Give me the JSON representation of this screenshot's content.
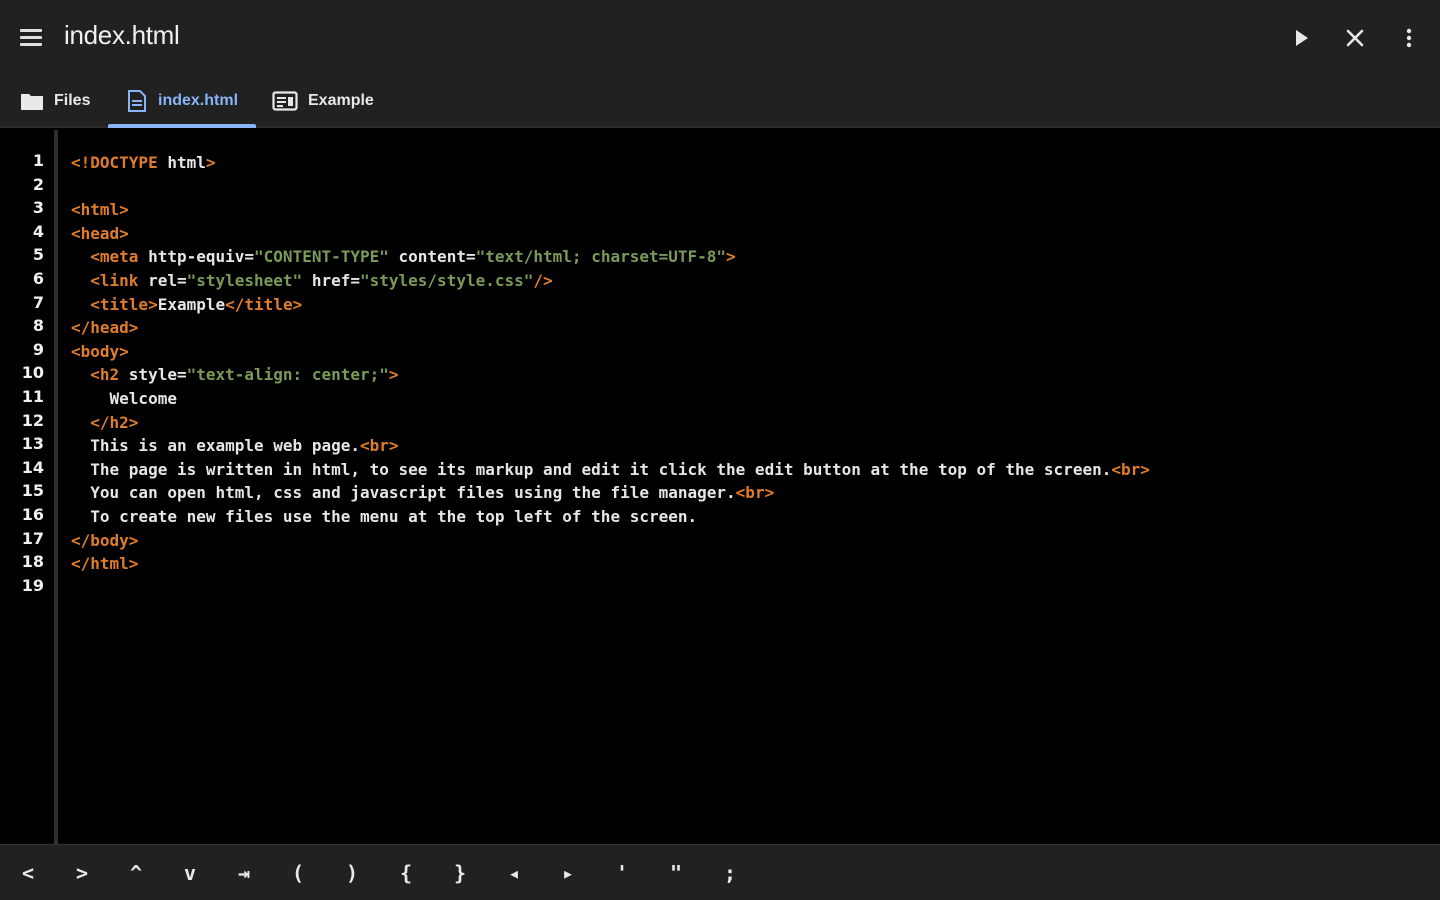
{
  "appbar": {
    "title": "index.html",
    "menu_icon": "hamburger-menu-icon",
    "actions": [
      {
        "name": "run-button",
        "icon": "play-icon"
      },
      {
        "name": "close-button",
        "icon": "close-icon"
      },
      {
        "name": "overflow-menu-button",
        "icon": "more-vert-icon"
      }
    ]
  },
  "tabs": [
    {
      "label": "Files",
      "icon": "folder-icon",
      "active": false
    },
    {
      "label": "index.html",
      "icon": "document-icon",
      "active": true
    },
    {
      "label": "Example",
      "icon": "web-preview-icon",
      "active": false
    }
  ],
  "editor": {
    "line_numbers": [
      "1",
      "2",
      "3",
      "4",
      "5",
      "6",
      "7",
      "8",
      "9",
      "10",
      "11",
      "12",
      "13",
      "14",
      "15",
      "16",
      "17",
      "18",
      "19"
    ],
    "lines": [
      [
        [
          "tag",
          "<!DOCTYPE "
        ],
        [
          "attr",
          "html"
        ],
        [
          "tag",
          ">"
        ]
      ],
      [],
      [
        [
          "tag",
          "<html>"
        ]
      ],
      [
        [
          "tag",
          "<head>"
        ]
      ],
      [
        [
          "text",
          "  "
        ],
        [
          "tag",
          "<meta "
        ],
        [
          "attr",
          "http-equiv="
        ],
        [
          "str",
          "\"CONTENT-TYPE\""
        ],
        [
          "attr",
          " content="
        ],
        [
          "str",
          "\"text/html; charset=UTF-8\""
        ],
        [
          "tag",
          ">"
        ]
      ],
      [
        [
          "text",
          "  "
        ],
        [
          "tag",
          "<link "
        ],
        [
          "attr",
          "rel="
        ],
        [
          "str",
          "\"stylesheet\""
        ],
        [
          "attr",
          " href="
        ],
        [
          "str",
          "\"styles/style.css\""
        ],
        [
          "tag",
          "/>"
        ]
      ],
      [
        [
          "text",
          "  "
        ],
        [
          "tag",
          "<title>"
        ],
        [
          "text",
          "Example"
        ],
        [
          "tag",
          "</title>"
        ]
      ],
      [
        [
          "tag",
          "</head>"
        ]
      ],
      [
        [
          "tag",
          "<body>"
        ]
      ],
      [
        [
          "text",
          "  "
        ],
        [
          "tag",
          "<h2 "
        ],
        [
          "attr",
          "style="
        ],
        [
          "str",
          "\"text-align: center;\""
        ],
        [
          "tag",
          ">"
        ]
      ],
      [
        [
          "text",
          "    Welcome"
        ]
      ],
      [
        [
          "text",
          "  "
        ],
        [
          "tag",
          "</h2>"
        ]
      ],
      [
        [
          "text",
          "  This is an example web page."
        ],
        [
          "tag",
          "<br>"
        ]
      ],
      [
        [
          "text",
          "  The page is written in html, to see its markup and edit it click the edit button at the top of the screen."
        ],
        [
          "tag",
          "<br>"
        ]
      ],
      [
        [
          "text",
          "  You can open html, css and javascript files using the file manager."
        ],
        [
          "tag",
          "<br>"
        ]
      ],
      [
        [
          "text",
          "  To create new files use the menu at the top left of the screen."
        ]
      ],
      [
        [
          "tag",
          "</body>"
        ]
      ],
      [
        [
          "tag",
          "</html>"
        ]
      ],
      []
    ]
  },
  "keybar": {
    "keys": [
      {
        "name": "cursor-left-key",
        "label": "<"
      },
      {
        "name": "cursor-right-key",
        "label": ">"
      },
      {
        "name": "cursor-up-key",
        "label": "^"
      },
      {
        "name": "cursor-down-key",
        "label": "v"
      },
      {
        "name": "tab-key",
        "label": "⇥"
      },
      {
        "name": "open-paren-key",
        "label": "("
      },
      {
        "name": "close-paren-key",
        "label": ")"
      },
      {
        "name": "open-brace-key",
        "label": "{"
      },
      {
        "name": "close-brace-key",
        "label": "}"
      },
      {
        "name": "less-than-key",
        "label": "◂"
      },
      {
        "name": "greater-than-key",
        "label": "▸"
      },
      {
        "name": "single-quote-key",
        "label": "'"
      },
      {
        "name": "double-quote-key",
        "label": "\""
      },
      {
        "name": "semicolon-key",
        "label": ";"
      }
    ]
  },
  "colors": {
    "tag": "#e07d2c",
    "string": "#7a9a57",
    "text": "#e6e6e6",
    "accent": "#8ab4f8",
    "bar": "#212121"
  }
}
